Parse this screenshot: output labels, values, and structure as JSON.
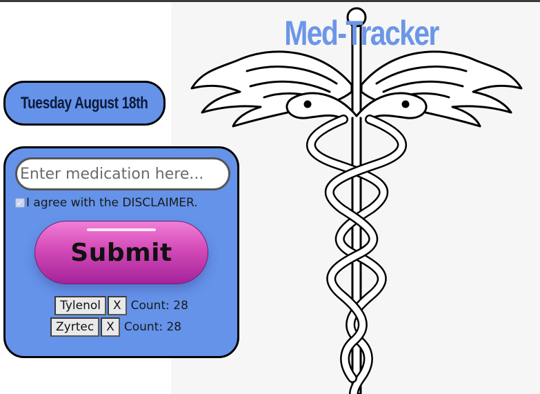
{
  "app": {
    "title": "Med-Tracker"
  },
  "date": {
    "label": "Tuesday August 18th"
  },
  "form": {
    "input_placeholder": "Enter medication here...",
    "input_value": "",
    "disclaimer_label": "I agree with the DISCLAIMER.",
    "disclaimer_checked": true,
    "submit_label": "Submit"
  },
  "medications": [
    {
      "name": "Tylenol",
      "remove_label": "X",
      "count_text": "Count: 28"
    },
    {
      "name": "Zyrtec",
      "remove_label": "X",
      "count_text": "Count: 28"
    }
  ],
  "colors": {
    "panel_blue": "#6493e9",
    "title_blue": "#6c96e6",
    "submit_pink": "#d44ab8",
    "background_gray": "#f6f6f6"
  },
  "icons": {
    "background_art": "caduceus-icon",
    "checkbox": "checkmark-icon"
  }
}
